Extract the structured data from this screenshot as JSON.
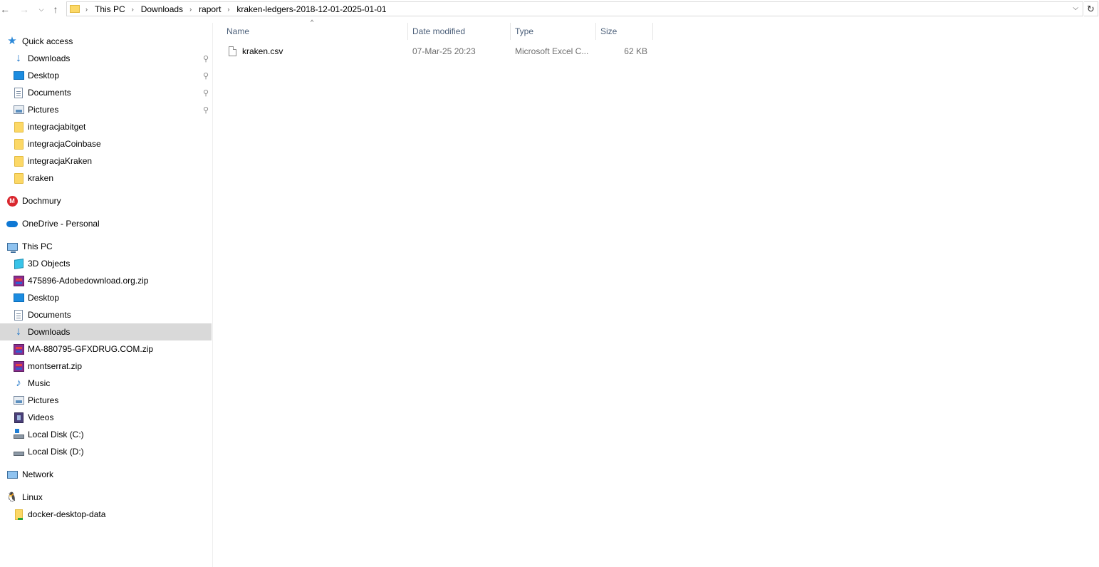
{
  "address_bar": {
    "breadcrumbs": [
      "This PC",
      "Downloads",
      "raport",
      "kraken-ledgers-2018-12-01-2025-01-01"
    ]
  },
  "icons": {
    "back": "back-arrow-icon",
    "forward": "forward-arrow-icon",
    "recent": "chevron-down-icon",
    "up": "up-arrow-icon",
    "refresh": "refresh-icon"
  },
  "nav": {
    "quick_access": {
      "label": "Quick access",
      "items": [
        {
          "label": "Downloads",
          "pinned": true
        },
        {
          "label": "Desktop",
          "pinned": true
        },
        {
          "label": "Documents",
          "pinned": true
        },
        {
          "label": "Pictures",
          "pinned": true
        },
        {
          "label": "integracjabitget",
          "pinned": false
        },
        {
          "label": "integracjaCoinbase",
          "pinned": false
        },
        {
          "label": "integracjaKraken",
          "pinned": false
        },
        {
          "label": "kraken",
          "pinned": false
        }
      ]
    },
    "dochmury": {
      "label": "Dochmury"
    },
    "onedrive": {
      "label": "OneDrive - Personal"
    },
    "this_pc": {
      "label": "This PC",
      "items": [
        {
          "label": "3D Objects"
        },
        {
          "label": "475896-Adobedownload.org.zip"
        },
        {
          "label": "Desktop"
        },
        {
          "label": "Documents"
        },
        {
          "label": "Downloads",
          "selected": true
        },
        {
          "label": "MA-880795-GFXDRUG.COM.zip"
        },
        {
          "label": "montserrat.zip"
        },
        {
          "label": "Music"
        },
        {
          "label": "Pictures"
        },
        {
          "label": "Videos"
        },
        {
          "label": "Local Disk (C:)"
        },
        {
          "label": "Local Disk (D:)"
        }
      ]
    },
    "network": {
      "label": "Network"
    },
    "linux": {
      "label": "Linux",
      "items": [
        {
          "label": "docker-desktop-data"
        }
      ]
    }
  },
  "file_list": {
    "columns": [
      "Name",
      "Date modified",
      "Type",
      "Size"
    ],
    "sorted_by": "Name",
    "files": [
      {
        "name": "kraken.csv",
        "date_modified": "07-Mar-25 20:23",
        "type": "Microsoft Excel C...",
        "size": "62 KB"
      }
    ]
  },
  "colors": {
    "selected_bg": "#d9d9d9",
    "header_text": "#4c607a",
    "accent_blue": "#1a73c8"
  }
}
